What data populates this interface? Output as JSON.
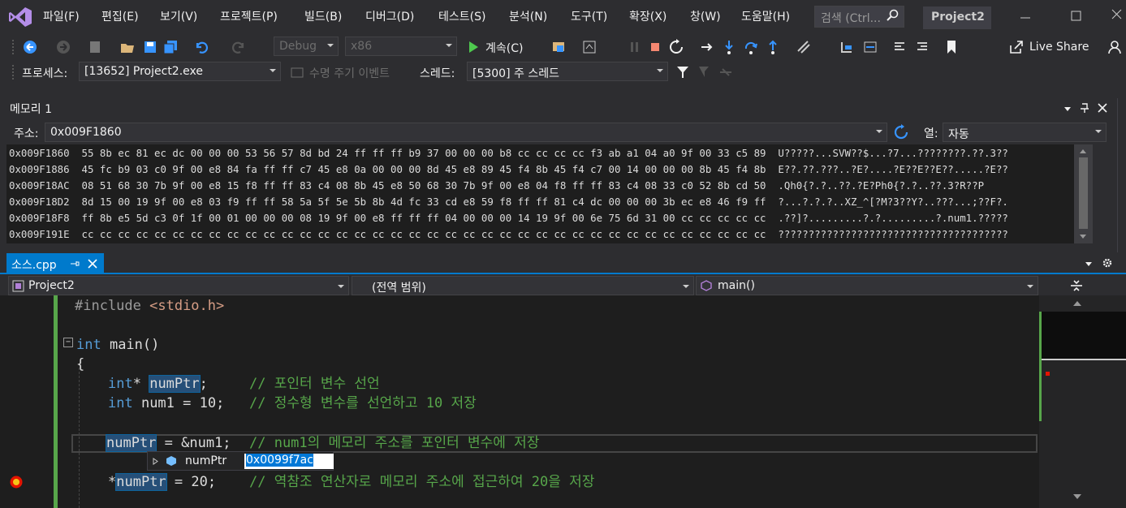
{
  "menu": {
    "items": [
      "파일(F)",
      "편집(E)",
      "보기(V)",
      "프로젝트(P)",
      "빌드(B)",
      "디버그(D)",
      "테스트(S)",
      "분석(N)",
      "도구(T)",
      "확장(X)",
      "창(W)",
      "도움말(H)"
    ],
    "search_placeholder": "검색 (Ctrl...",
    "project_name": "Project2"
  },
  "toolbar": {
    "config": "Debug",
    "platform": "x86",
    "continue_label": "계속(C)",
    "live_share": "Live Share"
  },
  "debug_location": {
    "process_label": "프로세스:",
    "process_value": "[13652] Project2.exe",
    "lifecycle_label": "수명 주기 이벤트",
    "thread_label": "스레드:",
    "thread_value": "[5300] 주 스레드"
  },
  "memory": {
    "title": "메모리 1",
    "address_label": "주소:",
    "address_value": "0x009F1860",
    "columns_label": "열:",
    "columns_value": "자동",
    "rows": [
      {
        "addr": "0x009F1860",
        "hex": "55 8b ec 81 ec dc 00 00 00 53 56 57 8d bd 24 ff ff ff b9 37 00 00 00 b8 cc cc cc cc f3 ab a1 04 a0 9f 00 33 c5 89",
        "ascii": "U?????...SVW??$...?7...????????.??.3??"
      },
      {
        "addr": "0x009F1886",
        "hex": "45 fc b9 03 c0 9f 00 e8 84 fa ff ff c7 45 e8 0a 00 00 00 8d 45 e8 89 45 f4 8b 45 f4 c7 00 14 00 00 00 8b 45 f4 8b",
        "ascii": "E??.??.???..?E?....?E??E??E??.....?E??"
      },
      {
        "addr": "0x009F18AC",
        "hex": "08 51 68 30 7b 9f 00 e8 15 f8 ff ff 83 c4 08 8b 45 e8 50 68 30 7b 9f 00 e8 04 f8 ff ff 83 c4 08 33 c0 52 8b cd 50",
        "ascii": ".Qh0{?.?..??.?E?Ph0{?.?..??.3?R??P"
      },
      {
        "addr": "0x009F18D2",
        "hex": "8d 15 00 19 9f 00 e8 03 f9 ff ff 58 5a 5f 5e 5b 8b 4d fc 33 cd e8 59 f8 ff ff 81 c4 dc 00 00 00 3b ec e8 46 f9 ff",
        "ascii": "?...?.?.?..XZ_^[?M?3??Y?..???...;??F?."
      },
      {
        "addr": "0x009F18F8",
        "hex": "ff 8b e5 5d c3 0f 1f 00 01 00 00 00 08 19 9f 00 e8 ff ff ff 04 00 00 00 14 19 9f 00 6e 75 6d 31 00 cc cc cc cc cc",
        "ascii": ".??]?.........?.?.........?.num1.?????"
      },
      {
        "addr": "0x009F191E",
        "hex": "cc cc cc cc cc cc cc cc cc cc cc cc cc cc cc cc cc cc cc cc cc cc cc cc cc cc cc cc cc cc cc cc cc cc cc cc cc cc",
        "ascii": "??????????????????????????????????????"
      }
    ]
  },
  "editor": {
    "tab_label": "소스.cpp",
    "nav_project": "Project2",
    "nav_scope": "(전역 범위)",
    "nav_member": "main()",
    "lines": {
      "l1_pp": "#include ",
      "l1_inc": "<stdio.h>",
      "l3_kw": "int",
      "l3_fn": " main()",
      "l4": "{",
      "l5_kw": "int",
      "l5_star": "* ",
      "l5_var": "numPtr",
      "l5_semi": ";",
      "l5_cm": "// 포인터 변수 선언",
      "l6_kw": "int",
      "l6_rest": " num1 = 10;",
      "l6_cm": "// 정수형 변수를 선언하고 10 저장",
      "l8_var": "numPtr",
      "l8_rest": " = &num1;",
      "l8_cm": "// num1의 메모리 주소를 포인터 변수에 저장",
      "l10_star": "*",
      "l10_var": "numPtr",
      "l10_rest": " = 20;",
      "l10_cm": "// 역참조 연산자로 메모리 주소에 접근하여 20을 저장"
    },
    "datatip": {
      "name": "numPtr",
      "value": "0x0099f7ac"
    }
  }
}
